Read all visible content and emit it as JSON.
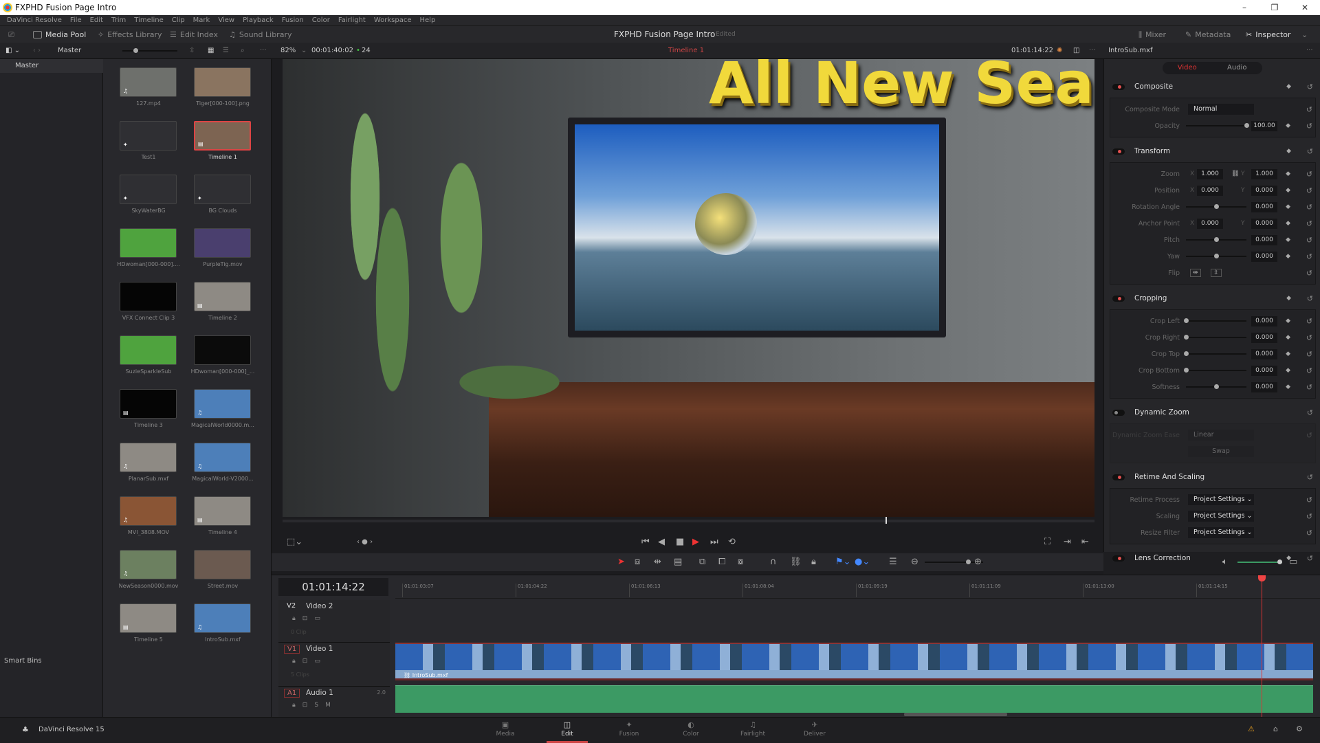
{
  "window": {
    "title": "FXPHD Fusion Page Intro",
    "minimize": "–",
    "maximize": "❐",
    "close": "✕"
  },
  "menu": [
    "DaVinci Resolve",
    "File",
    "Edit",
    "Trim",
    "Timeline",
    "Clip",
    "Mark",
    "View",
    "Playback",
    "Fusion",
    "Color",
    "Fairlight",
    "Workspace",
    "Help"
  ],
  "toolbar": {
    "media_pool": "Media Pool",
    "effects_library": "Effects Library",
    "edit_index": "Edit Index",
    "sound_library": "Sound Library",
    "project_title": "FXPHD Fusion Page Intro",
    "project_status": "Edited",
    "mixer": "Mixer",
    "metadata": "Metadata",
    "inspector": "Inspector"
  },
  "pool": {
    "bin": "Master",
    "zoom": "82%",
    "source_timecode": "00:01:40:02",
    "fps": "24",
    "timeline_name": "Timeline 1",
    "record_timecode": "01:01:14:22",
    "clip_name": "IntroSub.mxf"
  },
  "bins": {
    "master": "Master",
    "smart_bins": "Smart Bins"
  },
  "clips": [
    {
      "name": "127.mp4",
      "thumb": "#6e706c",
      "kind": "audio"
    },
    {
      "name": "Tiger[000-100].png",
      "thumb": "#8a7460",
      "kind": ""
    },
    {
      "name": "Test1",
      "thumb": "#2f2f33",
      "kind": "fusion"
    },
    {
      "name": "Timeline 1",
      "thumb": "#7d6452",
      "kind": "timeline",
      "selected": true
    },
    {
      "name": "SkyWaterBG",
      "thumb": "#2f2f33",
      "kind": "fusion"
    },
    {
      "name": "BG Clouds",
      "thumb": "#2f2f33",
      "kind": "fusion"
    },
    {
      "name": "HDwoman[000-000]....",
      "thumb": "#4fa33e",
      "kind": ""
    },
    {
      "name": "PurpleTig.mov",
      "thumb": "#4a3f6e",
      "kind": ""
    },
    {
      "name": "VFX Connect Clip 3",
      "thumb": "#050505",
      "kind": ""
    },
    {
      "name": "Timeline 2",
      "thumb": "#8e8a84",
      "kind": "timeline"
    },
    {
      "name": "SuzieSparkleSub",
      "thumb": "#4fa33e",
      "kind": ""
    },
    {
      "name": "HDwoman[000-000]_...",
      "thumb": "#0b0b0b",
      "kind": ""
    },
    {
      "name": "Timeline 3",
      "thumb": "#050505",
      "kind": "timeline"
    },
    {
      "name": "MagicalWorld0000.m...",
      "thumb": "#4d7fb9",
      "kind": "audio"
    },
    {
      "name": "PlanarSub.mxf",
      "thumb": "#8e8a84",
      "kind": "audio"
    },
    {
      "name": "MagicalWorld-V2000...",
      "thumb": "#4d7fb9",
      "kind": "audio"
    },
    {
      "name": "MVI_3808.MOV",
      "thumb": "#8a5535",
      "kind": "audio"
    },
    {
      "name": "Timeline 4",
      "thumb": "#8e8a84",
      "kind": "timeline"
    },
    {
      "name": "NewSeason0000.mov",
      "thumb": "#6c8060",
      "kind": "audio"
    },
    {
      "name": "Street.mov",
      "thumb": "#6b5a50",
      "kind": ""
    },
    {
      "name": "Timeline 5",
      "thumb": "#8e8a84",
      "kind": "timeline"
    },
    {
      "name": "IntroSub.mxf",
      "thumb": "#4d7fb9",
      "kind": "audio"
    }
  ],
  "viewer": {
    "headline": "All New Seas"
  },
  "inspector": {
    "clip": "IntroSub.mxf",
    "tabs": [
      "Video",
      "Audio"
    ],
    "composite": {
      "title": "Composite",
      "mode_label": "Composite Mode",
      "mode": "Normal",
      "opacity_label": "Opacity",
      "opacity": "100.00",
      "opacity_pct": 100
    },
    "transform": {
      "title": "Transform",
      "zoom_label": "Zoom",
      "zoom_x": "1.000",
      "zoom_y": "1.000",
      "position_label": "Position",
      "position_x": "0.000",
      "position_y": "0.000",
      "rotation_label": "Rotation Angle",
      "rotation": "0.000",
      "anchor_label": "Anchor Point",
      "anchor_x": "0.000",
      "anchor_y": "0.000",
      "pitch_label": "Pitch",
      "pitch": "0.000",
      "yaw_label": "Yaw",
      "yaw": "0.000",
      "flip_label": "Flip",
      "x": "X",
      "y": "Y"
    },
    "cropping": {
      "title": "Cropping",
      "rows": [
        {
          "label": "Crop Left",
          "value": "0.000"
        },
        {
          "label": "Crop Right",
          "value": "0.000"
        },
        {
          "label": "Crop Top",
          "value": "0.000"
        },
        {
          "label": "Crop Bottom",
          "value": "0.000"
        },
        {
          "label": "Softness",
          "value": "0.000",
          "center": true
        }
      ]
    },
    "dynamic_zoom": {
      "title": "Dynamic Zoom",
      "ease_label": "Dynamic Zoom Ease",
      "ease": "Linear",
      "swap": "Swap",
      "enabled": false
    },
    "retime": {
      "title": "Retime And Scaling",
      "rows": [
        {
          "label": "Retime Process",
          "value": "Project Settings"
        },
        {
          "label": "Scaling",
          "value": "Project Settings"
        },
        {
          "label": "Resize Filter",
          "value": "Project Settings"
        }
      ]
    },
    "lens": {
      "title": "Lens Correction"
    }
  },
  "timeline": {
    "timecode": "01:01:14:22",
    "ruler": [
      "01:01:03:07",
      "01:01:04:22",
      "01:01:06:13",
      "01:01:08:04",
      "01:01:09:19",
      "01:01:11:09",
      "01:01:13:00",
      "01:01:14:15"
    ],
    "tracks": [
      {
        "id": "V2",
        "name": "Video 2",
        "count": "0 Clip"
      },
      {
        "id": "V1",
        "name": "Video 1",
        "count": "5 Clips"
      },
      {
        "id": "A1",
        "name": "Audio 1",
        "channels": "2.0"
      }
    ],
    "clip_label": "IntroSub.mxf",
    "solo": "S",
    "mute": "M"
  },
  "footer": {
    "app": "DaVinci Resolve 15",
    "pages": [
      {
        "label": "Media",
        "icon": "▣"
      },
      {
        "label": "Edit",
        "icon": "◫",
        "active": true
      },
      {
        "label": "Fusion",
        "icon": "✦"
      },
      {
        "label": "Color",
        "icon": "◐"
      },
      {
        "label": "Fairlight",
        "icon": "♫"
      },
      {
        "label": "Deliver",
        "icon": "✈"
      }
    ]
  },
  "colors": {
    "accent": "#e45050",
    "video_clip": "#86a8cf",
    "audio_clip": "#3c9a64",
    "playhead": "#dd3333"
  }
}
